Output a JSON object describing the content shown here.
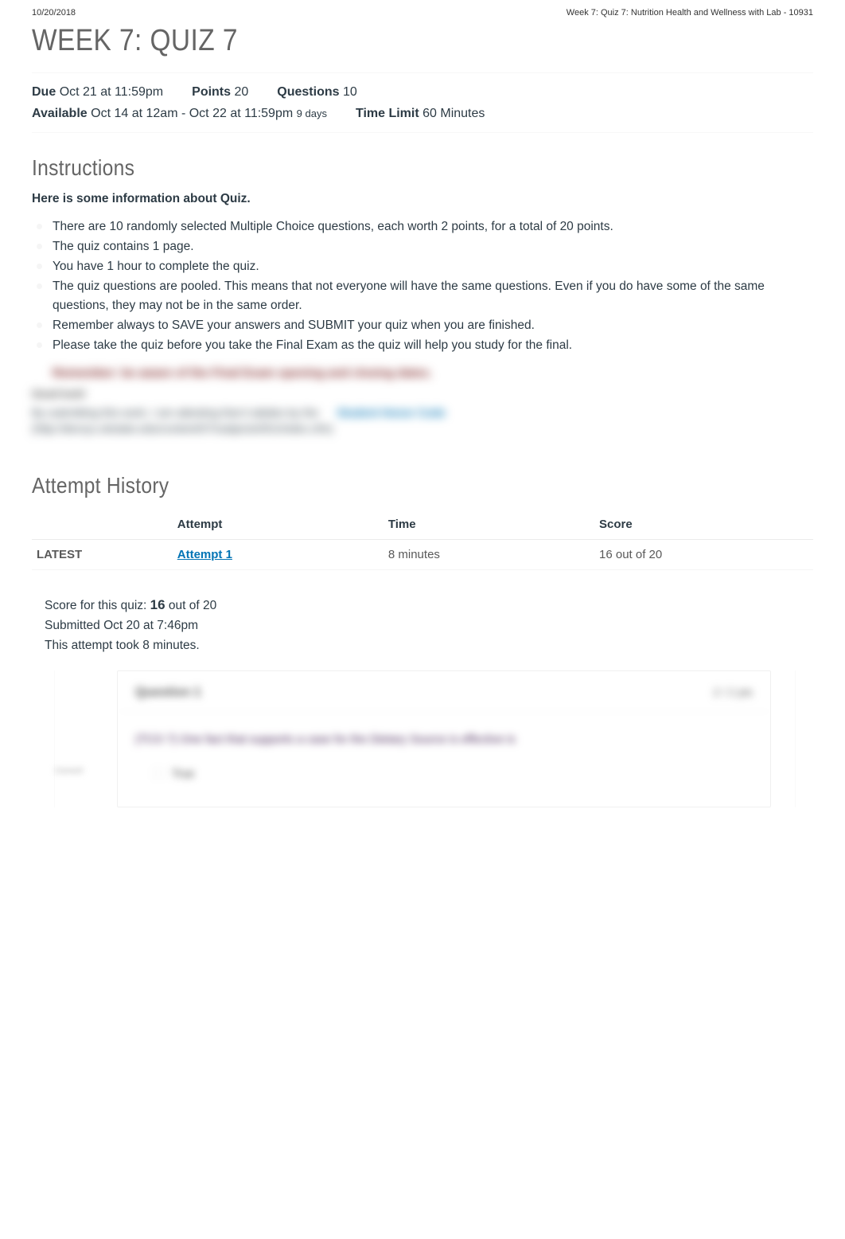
{
  "header": {
    "date": "10/20/2018",
    "course": "Week 7: Quiz 7: Nutrition Health and Wellness with Lab - 10931"
  },
  "title": "WEEK 7: QUIZ 7",
  "meta": {
    "due_label": "Due",
    "due_value": "Oct 21 at 11:59pm",
    "points_label": "Points",
    "points_value": "20",
    "questions_label": "Questions",
    "questions_value": "10",
    "available_label": "Available",
    "available_value": "Oct 14 at 12am - Oct 22 at 11:59pm",
    "available_days": "9 days",
    "timelimit_label": "Time Limit",
    "timelimit_value": "60 Minutes"
  },
  "instructions": {
    "heading": "Instructions",
    "intro": "Here is some information about Quiz.",
    "items": [
      "There are 10 randomly selected Multiple Choice questions, each worth 2 points, for a total of 20 points.",
      "The quiz contains 1 page.",
      "You have 1 hour to complete the quiz.",
      "The quiz questions are pooled. This means that not everyone will have the same questions. Even if you do have some of the same questions, they may not be in the same order.",
      "Remember always to SAVE your answers and SUBMIT your quiz when you are finished.",
      "Please take the quiz before you take the Final Exam as the quiz will help you study for the final."
    ],
    "blurred_bullet": "Remember: be aware of the Final Exam opening and closing dates.",
    "blurred_label": "Good luck!",
    "blurred_line1_a": "By submitting this work, I am attesting that it abides by the",
    "blurred_line1_link": "Student Honor Code",
    "blurred_line2": "(http://devryu.okstate.edu/content/07/subjects/001/index.cfm)"
  },
  "history": {
    "heading": "Attempt History",
    "cols": {
      "c1": "",
      "c2": "Attempt",
      "c3": "Time",
      "c4": "Score"
    },
    "row": {
      "latest": "LATEST",
      "attempt": "Attempt 1",
      "time": "8 minutes",
      "score": "16 out of 20"
    }
  },
  "score_block": {
    "line1_a": "Score for this quiz: ",
    "line1_b": "16",
    "line1_c": " out of 20",
    "line2": "Submitted Oct 20 at 7:46pm",
    "line3": "This attempt took 8 minutes."
  },
  "question1": {
    "title": "Question 1",
    "pts": "2 / 2 pts",
    "text": "(TCO 7) One fact that supports a case for the Dietary Source is effective is",
    "side": "Correct!",
    "answer": "True"
  }
}
